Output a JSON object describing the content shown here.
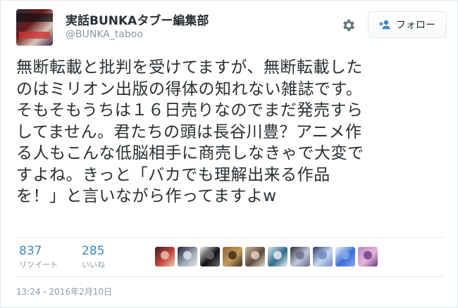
{
  "user": {
    "display_name": "実話BUNKAタブー編集部",
    "handle": "@BUNKA_taboo"
  },
  "follow_button": {
    "label": "フォロー",
    "icon": "add-user-icon"
  },
  "settings_icon": "gear-icon",
  "tweet": {
    "lines": [
      "無断転載と批判を受けてますが、無断転載した",
      "のはミリオン出版の得体の知れない雑誌です。",
      "そもそもうちは１６日売りなのでまだ発売すら",
      "してません。君たちの頭は長谷川豊？アニメ作",
      "る人もこんな低脳相手に商売しなきゃで大変で",
      "すよね。きっと「バカでも理解出来る作品",
      "を！」と言いながら作ってますよw"
    ]
  },
  "stats": {
    "retweets": {
      "count": "837",
      "label": "リツイート"
    },
    "likes": {
      "count": "285",
      "label": "いいね"
    }
  },
  "likers": [
    {
      "colors": [
        "#3a1e2a",
        "#c8463c",
        "#e9c9b4"
      ]
    },
    {
      "colors": [
        "#1d2330",
        "#9aa5b5",
        "#e6e9ef"
      ]
    },
    {
      "colors": [
        "#f2f2f2",
        "#111111",
        "#6d6d6d"
      ]
    },
    {
      "colors": [
        "#8a6a3a",
        "#c49a5a",
        "#3a2a1a"
      ]
    },
    {
      "colors": [
        "#cdb9a4",
        "#5b4a3d",
        "#e8dccd"
      ]
    },
    {
      "colors": [
        "#d7e6ee",
        "#2e6e8e",
        "#f1f1f1"
      ]
    },
    {
      "colors": [
        "#2a2a3a",
        "#bfc7d8",
        "#6a6a8a"
      ]
    },
    {
      "colors": [
        "#2b3b6b",
        "#c9d8f0",
        "#6b87c7"
      ]
    },
    {
      "colors": [
        "#f4f7ff",
        "#3b6fd6",
        "#86a8e8"
      ]
    },
    {
      "colors": [
        "#b387c9",
        "#e9b4d8",
        "#6a3a8a"
      ]
    }
  ],
  "timestamp": "13:24 - 2016年2月10日",
  "colors": {
    "link_blue": "#3b88c3",
    "muted": "#8899a6",
    "text": "#292f33",
    "border": "#e1e8ed"
  }
}
